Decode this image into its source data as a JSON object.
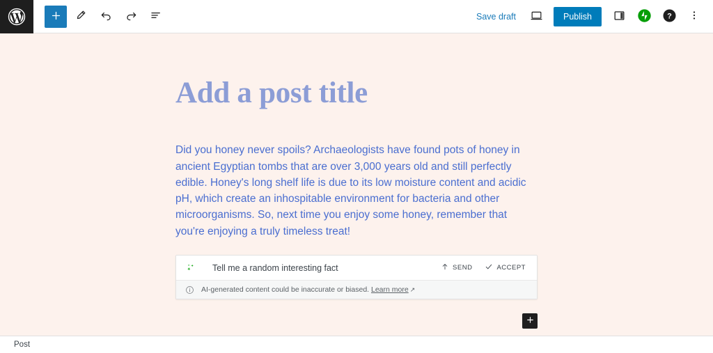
{
  "header": {
    "logo_label": "WordPress",
    "tools": [
      {
        "name": "add-block-button",
        "label": "Add block",
        "icon": "plus-icon"
      },
      {
        "name": "edit-mode-button",
        "label": "Edit",
        "icon": "pencil-icon"
      },
      {
        "name": "undo-button",
        "label": "Undo",
        "icon": "undo-icon"
      },
      {
        "name": "redo-button",
        "label": "Redo",
        "icon": "redo-icon"
      },
      {
        "name": "document-overview-button",
        "label": "Document Overview",
        "icon": "list-view-icon"
      }
    ],
    "save_draft_label": "Save draft",
    "preview_label": "Preview",
    "preview_icon": "desktop-icon",
    "publish_label": "Publish",
    "settings_label": "Settings",
    "settings_icon": "sidebar-toggle-icon",
    "jetpack_label": "Jetpack",
    "jetpack_icon": "jetpack-icon",
    "help_label": "Help",
    "help_icon": "help-circle-icon",
    "options_label": "Options",
    "options_icon": "three-dots-vertical-icon"
  },
  "content": {
    "title_placeholder": "Add a post title",
    "paragraph": "Did you honey never spoils? Archaeologists have found pots of honey in ancient Egyptian tombs that are over 3,000 years old and still perfectly edible. Honey's long shelf life is due to its low moisture content and acidic pH, which create an inhospitable environment for bacteria and other microorganisms. So, next time you enjoy some honey, remember that you're enjoying a truly timeless treat!"
  },
  "ai_block": {
    "sparkle_icon": "ai-sparkle-icon",
    "prompt_value": "Tell me a random interesting fact",
    "send_label": "SEND",
    "send_icon": "arrow-up-icon",
    "accept_label": "ACCEPT",
    "accept_icon": "checkmark-icon",
    "disclaimer_icon": "info-circle-icon",
    "disclaimer_text": "AI-generated content could be inaccurate or biased.",
    "learn_more_label": "Learn more",
    "external_link_icon": "external-link-icon"
  },
  "appender": {
    "label": "Add block",
    "icon": "plus-icon"
  },
  "footer": {
    "breadcrumb": "Post"
  },
  "colors": {
    "canvas_background": "#fdf2ed",
    "title_text": "#8c9dd6",
    "body_text": "#4a6ed0",
    "publish_button": "#007cba",
    "toolbar_add_button": "#1a7bb9",
    "jetpack_green": "#069e08",
    "dark_chrome": "#1e1e1e"
  }
}
